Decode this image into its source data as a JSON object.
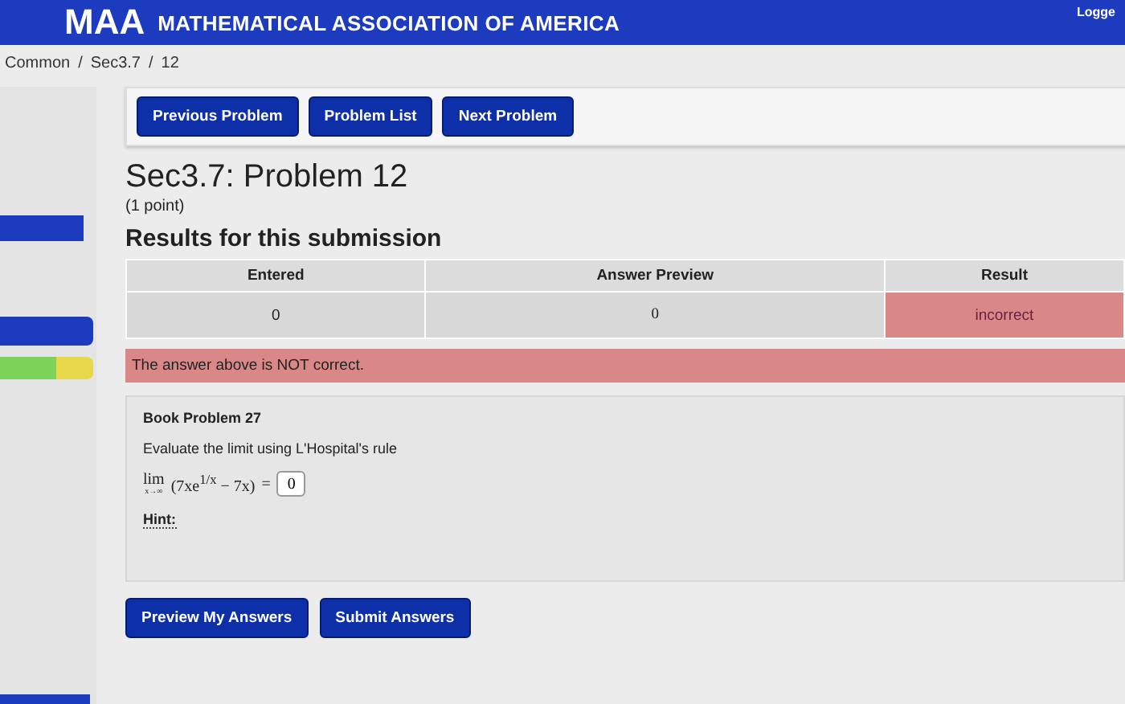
{
  "header": {
    "logo": "MAA",
    "title": "MATHEMATICAL ASSOCIATION OF AMERICA",
    "user": "Logge"
  },
  "breadcrumb": [
    {
      "label": "Common"
    },
    {
      "sep": "/",
      "label": "Sec3.7"
    },
    {
      "sep": "/",
      "label": "12"
    }
  ],
  "sidebar": {
    "progress": {
      "level": 0.6
    }
  },
  "nav_buttons": [
    "Previous Problem",
    "Problem List",
    "Next Problem"
  ],
  "problem": {
    "title": "Sec3.7: Problem 12",
    "points": "(1 point)"
  },
  "results": {
    "heading": "Results for this submission",
    "columns": [
      "Entered",
      "Answer Preview",
      "Result"
    ],
    "row": {
      "entered": "0",
      "preview": "0",
      "result": "incorrect",
      "correct": false
    },
    "message": "The answer above is NOT correct."
  },
  "question": {
    "title": "Book Problem 27",
    "text": "Evaluate the limit using L'Hospital's rule",
    "limit": {
      "op": "lim",
      "sub": "x→∞",
      "expr": "(7xe$^{1/x}$ − 7x)",
      "eq": "=",
      "answer": "0"
    },
    "hint": "Hint:"
  },
  "actions": [
    "Preview My Answers",
    "Submit Answers"
  ]
}
